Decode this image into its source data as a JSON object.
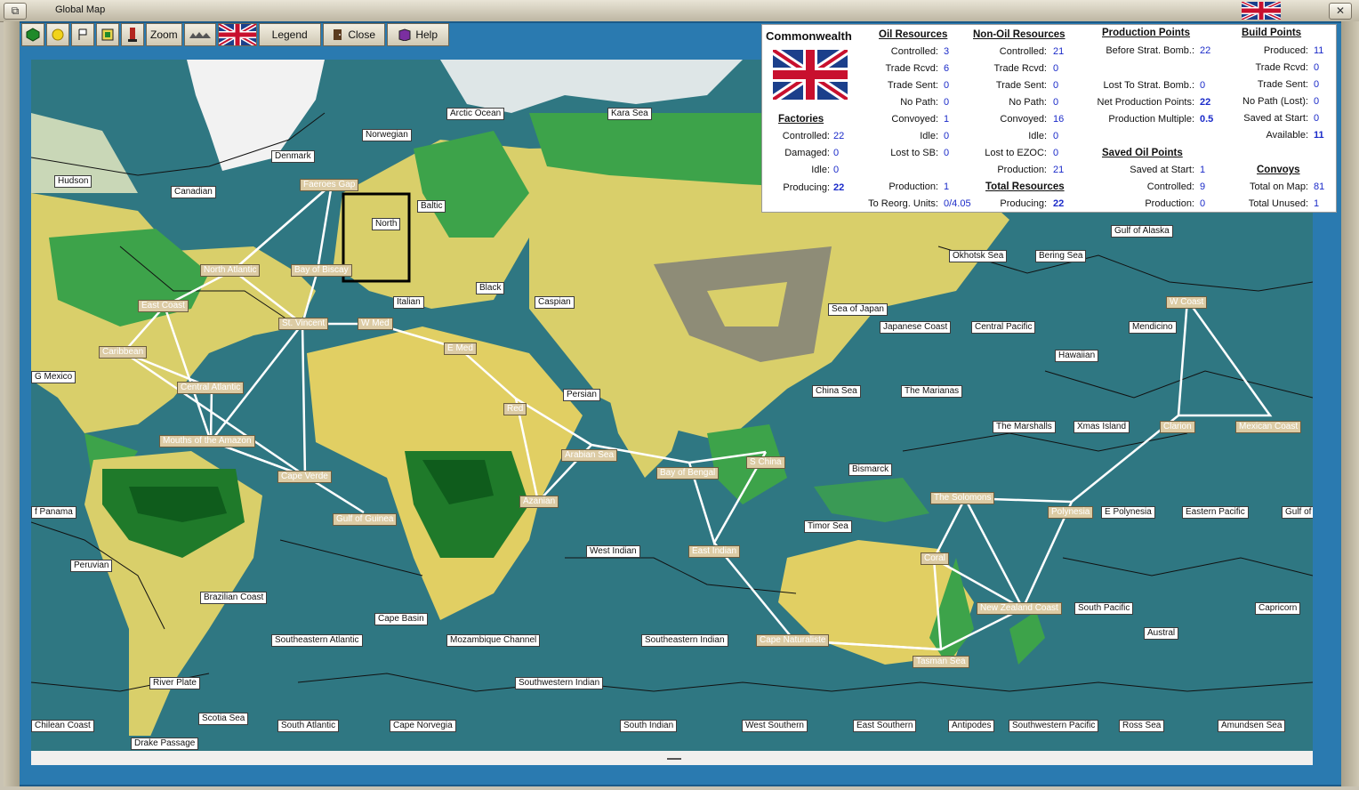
{
  "window": {
    "title": "Global Map",
    "close_glyph": "✕",
    "maximize_glyph": "▭",
    "restore_glyph": "⧉"
  },
  "toolbar": {
    "zoom_label": "Zoom",
    "legend_label": "Legend",
    "close_label": "Close",
    "help_label": "Help"
  },
  "colors": {
    "sea": "#2f7782",
    "land_yellow": "#e1cf63",
    "land_green": "#3da34a",
    "mountain": "#7a7a7a",
    "zone_box": "#dccba4",
    "value_blue": "#1b2bc9"
  },
  "info": {
    "nation": "Commonwealth",
    "factories": {
      "title": "Factories",
      "controlled_label": "Controlled:",
      "controlled": "22",
      "damaged_label": "Damaged:",
      "damaged": "0",
      "idle_label": "Idle:",
      "idle": "0",
      "producing_label": "Producing:",
      "producing": "22"
    },
    "oil": {
      "title": "Oil Resources",
      "controlled_label": "Controlled:",
      "controlled": "3",
      "trade_rcvd_label": "Trade Rcvd:",
      "trade_rcvd": "6",
      "trade_sent_label": "Trade Sent:",
      "trade_sent": "0",
      "no_path_label": "No Path:",
      "no_path": "0",
      "convoyed_label": "Convoyed:",
      "convoyed": "1",
      "idle_label": "Idle:",
      "idle": "0",
      "lost_sb_label": "Lost to SB:",
      "lost_sb": "0",
      "production_label": "Production:",
      "production": "1",
      "reorg_label": "To Reorg. Units:",
      "reorg": "0/4.05"
    },
    "nonoil": {
      "title": "Non-Oil Resources",
      "controlled_label": "Controlled:",
      "controlled": "21",
      "trade_rcvd_label": "Trade Rcvd:",
      "trade_rcvd": "0",
      "trade_sent_label": "Trade Sent:",
      "trade_sent": "0",
      "no_path_label": "No Path:",
      "no_path": "0",
      "convoyed_label": "Convoyed:",
      "convoyed": "16",
      "idle_label": "Idle:",
      "idle": "0",
      "lost_ezoc_label": "Lost to EZOC:",
      "lost_ezoc": "0",
      "production_label": "Production:",
      "production": "21"
    },
    "total": {
      "title": "Total Resources",
      "producing_label": "Producing:",
      "producing": "22"
    },
    "pp": {
      "title": "Production Points",
      "before_label": "Before Strat. Bomb.:",
      "before": "22",
      "lost_label": "Lost To Strat. Bomb.:",
      "lost": "0",
      "net_label": "Net Production Points:",
      "net": "22",
      "mult_label": "Production Multiple:",
      "mult": "0.5"
    },
    "saved_oil": {
      "title": "Saved Oil Points",
      "saved_label": "Saved at Start:",
      "saved": "1",
      "controlled_label": "Controlled:",
      "controlled": "9",
      "production_label": "Production:",
      "production": "0"
    },
    "bp": {
      "title": "Build Points",
      "produced_label": "Produced:",
      "produced": "11",
      "trade_rcvd_label": "Trade Rcvd:",
      "trade_rcvd": "0",
      "trade_sent_label": "Trade Sent:",
      "trade_sent": "0",
      "no_path_label": "No Path (Lost):",
      "no_path": "0",
      "saved_label": "Saved at Start:",
      "saved": "0",
      "available_label": "Available:",
      "available": "11"
    },
    "convoys": {
      "title": "Convoys",
      "total_label": "Total on Map:",
      "total": "81",
      "unused_label": "Total Unused:",
      "unused": "1"
    }
  },
  "sea_labels": [
    "Arctic Ocean",
    "Kara Sea",
    "Norwegian",
    "Denmark",
    "Hudson",
    "Canadian",
    "Baltic",
    "North",
    "Black",
    "Italian",
    "Caspian",
    "Persian",
    "G Mexico",
    "Okhotsk Sea",
    "Bering Sea",
    "Gulf of Alaska",
    "Sea of Japan",
    "Japanese Coast",
    "Central Pacific",
    "Mendicino",
    "Hawaiian",
    "China Sea",
    "The Marianas",
    "The Marshalls",
    "Xmas Island",
    "Bismarck",
    "Timor Sea",
    "West Indian",
    "f Panama",
    "Peruvian",
    "Brazilian Coast",
    "Cape Basin",
    "Southeastern Atlantic",
    "Mozambique Channel",
    "Southeastern Indian",
    "Southwestern Indian",
    "River Plate",
    "Scotia Sea",
    "Chilean Coast",
    "Drake Passage",
    "South Atlantic",
    "Cape Norvegia",
    "South Indian",
    "West Southern",
    "East Southern",
    "Antipodes",
    "Southwestern Pacific",
    "Ross Sea",
    "Amundsen Sea",
    "South Pacific",
    "Austral",
    "Capricorn",
    "Eastern Pacific",
    "Gulf of",
    "E Polynesia"
  ],
  "zone_labels": [
    "Faeroes Gap",
    "North Atlantic",
    "Bay of Biscay",
    "East Coast",
    "St. Vincent",
    "W Med",
    "E Med",
    "Caribbean",
    "Central Atlantic",
    "Mouths of the Amazon",
    "Cape Verde",
    "Gulf of Guinea",
    "Red",
    "Arabian Sea",
    "Azanian",
    "Bay of Bengal",
    "S China",
    "East Indian",
    "The Solomons",
    "Polynesia",
    "Coral",
    "New Zealand Coast",
    "Cape Naturaliste",
    "Tasman Sea",
    "W Coast",
    "Clarion",
    "Mexican Coast"
  ]
}
